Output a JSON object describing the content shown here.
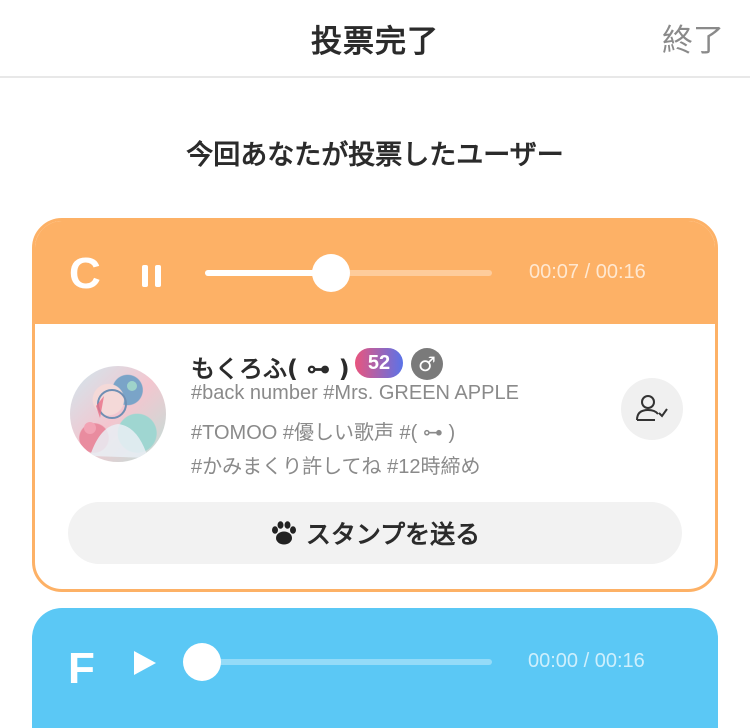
{
  "header": {
    "title": "投票完了",
    "end_label": "終了"
  },
  "subtitle": "今回あなたが投票したユーザー",
  "colors": {
    "orange": "#fdb166",
    "blue": "#5bc8f5"
  },
  "cards": [
    {
      "grade": "C",
      "control": "pause-icon",
      "time": "00:07 / 00:16",
      "progress": 0.44,
      "user": {
        "name": "もくろふ( ⊶ )",
        "age_badge": "52",
        "gender": "♂",
        "tags": [
          "#back number #Mrs. GREEN APPLE",
          "#TOMOO #優しい歌声 #( ⊶ )",
          "#かみまくり許してね #12時締め"
        ]
      },
      "stamp_button": "スタンプを送る"
    },
    {
      "grade": "F",
      "control": "play-icon",
      "time": "00:00 / 00:16",
      "progress": 0.0
    }
  ]
}
